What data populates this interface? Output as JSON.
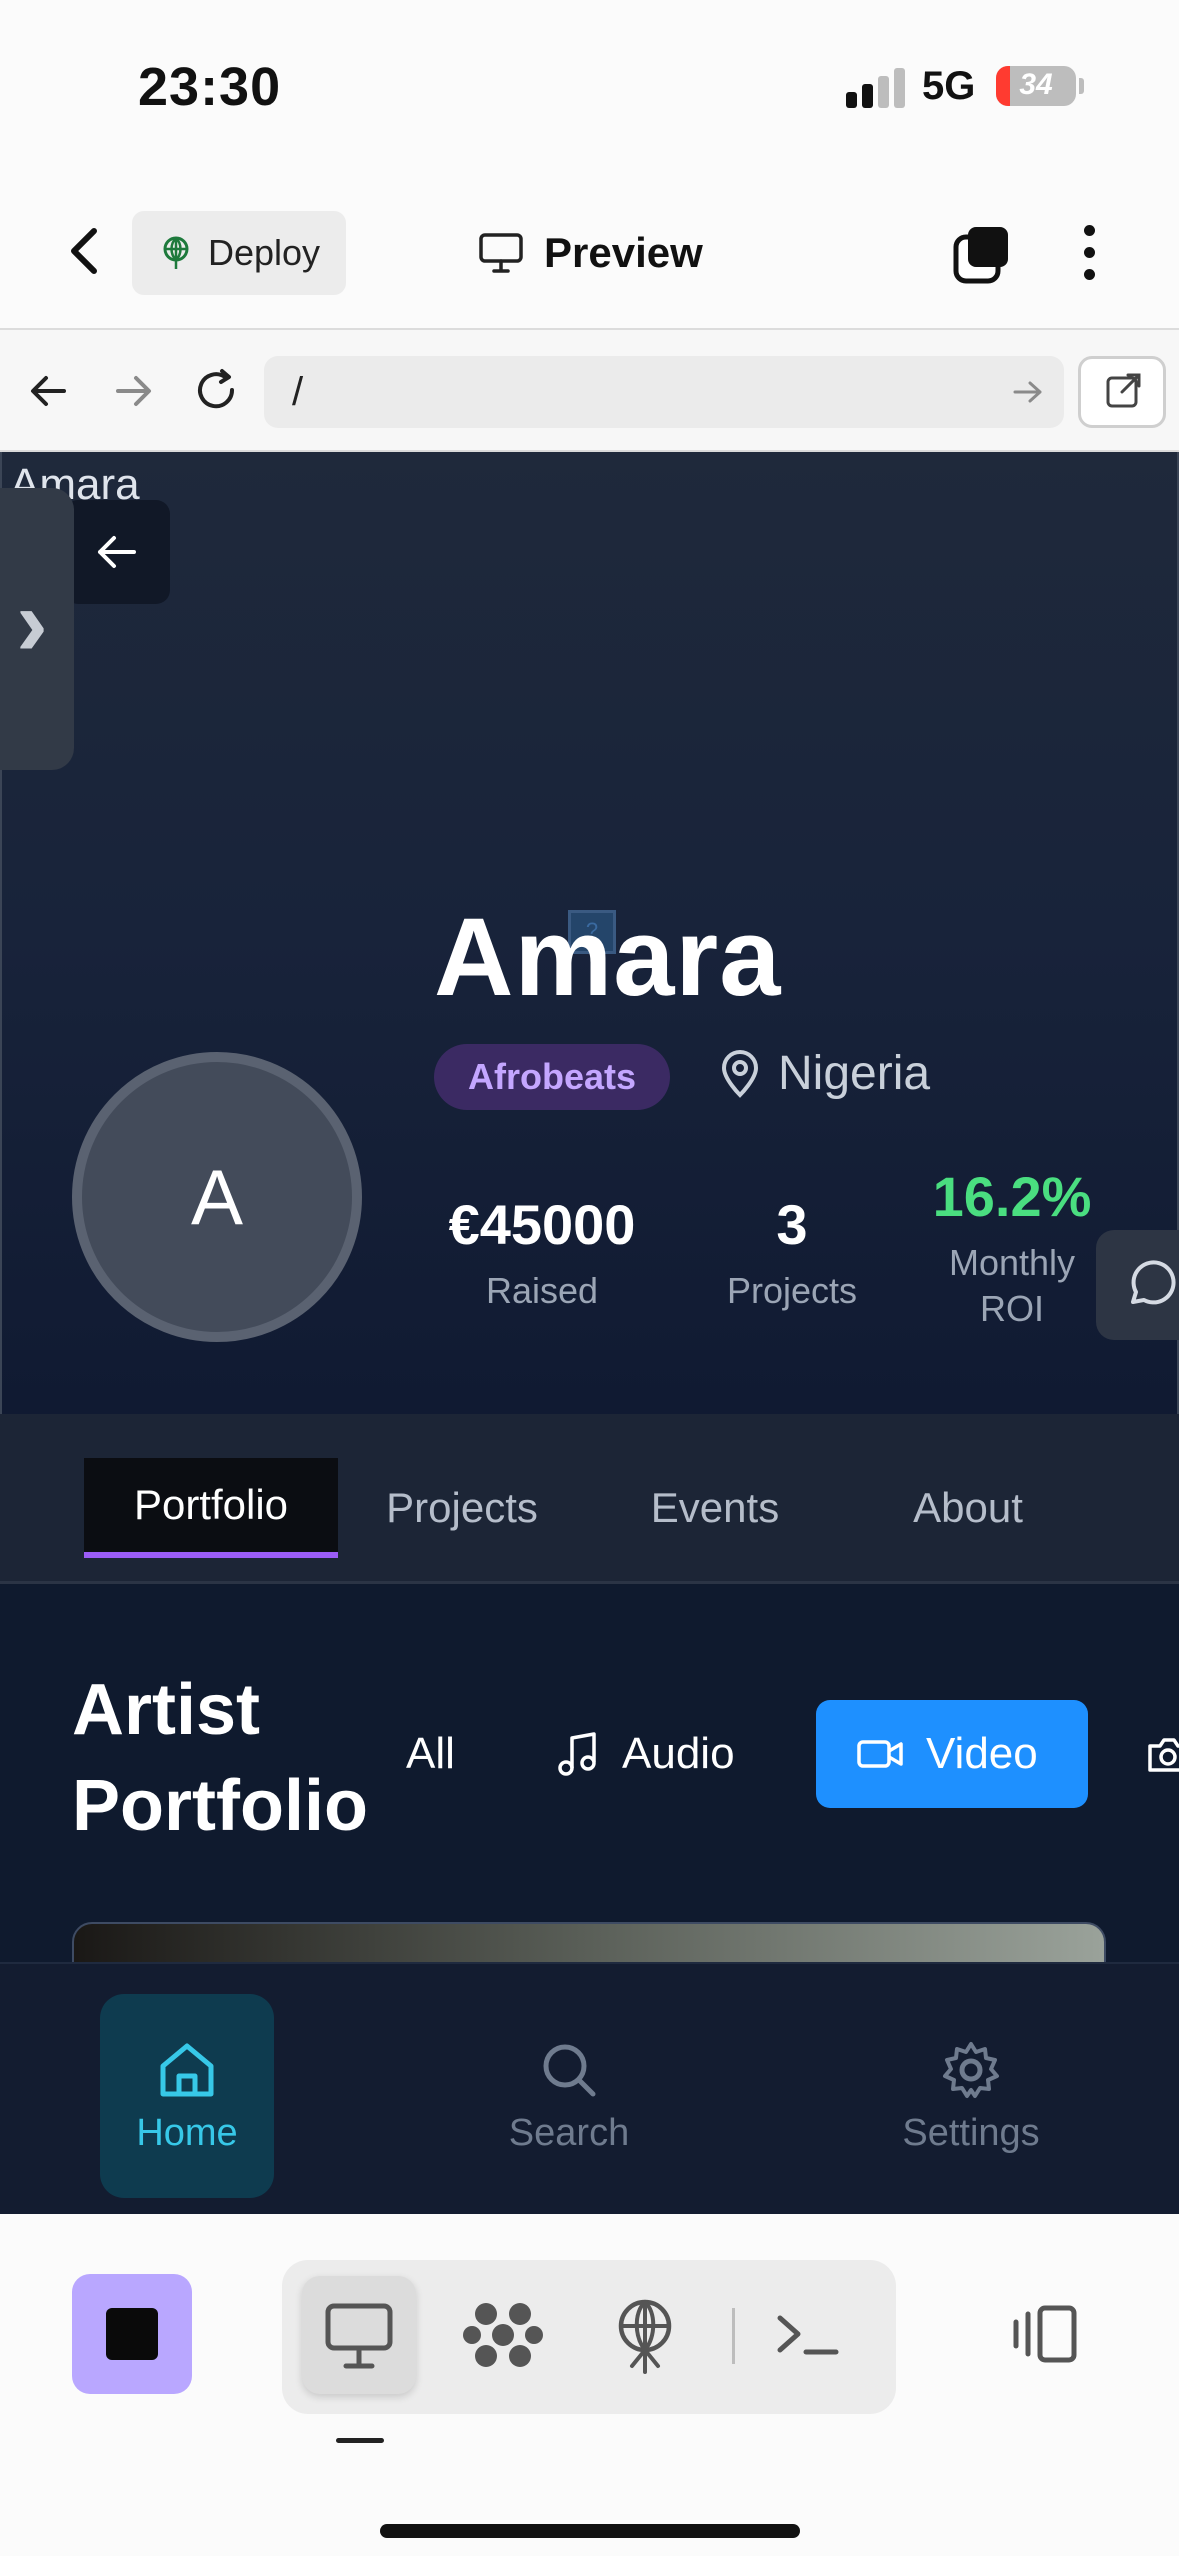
{
  "status_bar": {
    "time": "23:30",
    "network": "5G",
    "battery": "34"
  },
  "app_bar": {
    "deploy_label": "Deploy",
    "preview_label": "Preview"
  },
  "browser": {
    "url": "/"
  },
  "profile": {
    "header_fragment": "Amara",
    "name": "Amara",
    "genre": "Afrobeats",
    "location": "Nigeria",
    "avatar_initial": "A",
    "broken_image_glyph": "?",
    "stats": [
      {
        "value": "€45000",
        "label": "Raised"
      },
      {
        "value": "3",
        "label": "Projects"
      },
      {
        "value": "16.2%",
        "label": "Monthly ROI"
      }
    ],
    "roi_color": "#4ade80"
  },
  "tabs": [
    "Portfolio",
    "Projects",
    "Events",
    "About"
  ],
  "active_tab": "Portfolio",
  "portfolio": {
    "title_line1": "Artist",
    "title_line2": "Portfolio",
    "filters": [
      "All",
      "Audio",
      "Video"
    ],
    "active_filter": "Video"
  },
  "bottom_nav": {
    "items": [
      {
        "label": "Home",
        "icon": "home-icon"
      },
      {
        "label": "Search",
        "icon": "search-icon"
      },
      {
        "label": "Settings",
        "icon": "gear-icon"
      }
    ],
    "active": "Home"
  },
  "colors": {
    "accent_purple": "#9b5cf6",
    "accent_blue": "#1e90ff",
    "accent_cyan": "#37c8e8",
    "stop_button": "#b9a7ff"
  }
}
